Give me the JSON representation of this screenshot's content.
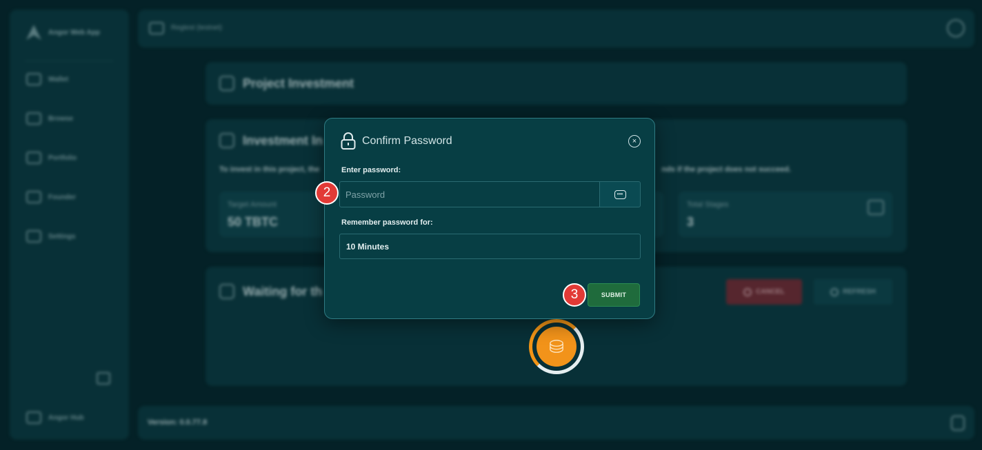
{
  "app": {
    "name": "Angor Web App",
    "version_label": "Version: 0.0.77.8"
  },
  "sidebar": {
    "items": [
      {
        "label": "Wallet",
        "icon": "wallet-icon"
      },
      {
        "label": "Browse",
        "icon": "browse-icon"
      },
      {
        "label": "Portfolio",
        "icon": "portfolio-icon"
      },
      {
        "label": "Founder",
        "icon": "founder-icon"
      },
      {
        "label": "Settings",
        "icon": "settings-icon"
      }
    ],
    "hub_label": "Angor Hub"
  },
  "topbar": {
    "network_label": "Regtest (testnet)"
  },
  "main": {
    "project_title": "Project Investment",
    "info_title": "Investment In",
    "info_text_left": "To invest in this project, the",
    "info_text_right": "nds if the project does not succeed.",
    "stats": [
      {
        "label": "Target Amount",
        "value": "50 TBTC"
      },
      {
        "label": "Total Stages",
        "value": "3"
      }
    ],
    "waiting_title": "Waiting for th",
    "cancel_label": "CANCEL",
    "refresh_label": "REFRESH"
  },
  "modal": {
    "title": "Confirm Password",
    "password_label": "Enter password:",
    "password_placeholder": "Password",
    "password_value": "",
    "remember_label": "Remember password for:",
    "remember_selected": "10 Minutes",
    "submit_label": "SUBMIT"
  },
  "annotations": {
    "badge_password": "2",
    "badge_submit": "3"
  },
  "colors": {
    "accent_submit": "#1f6b3c",
    "badge": "#e23a36",
    "spinner": "#f2931a"
  }
}
